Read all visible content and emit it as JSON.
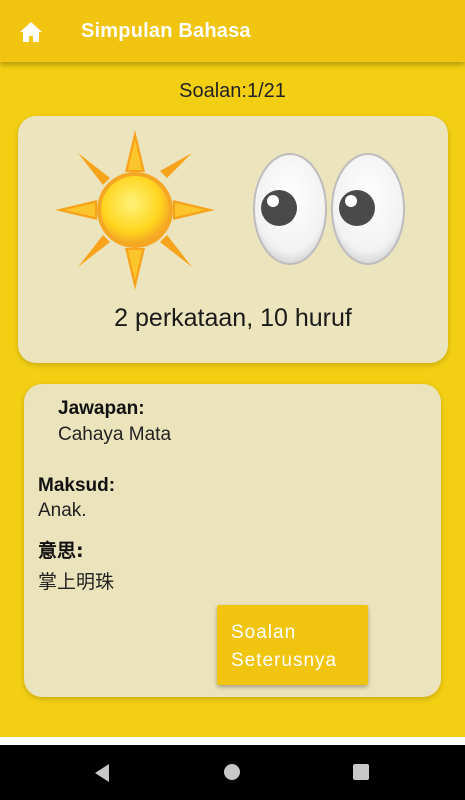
{
  "appbar": {
    "title": "Simpulan Bahasa",
    "home_icon": "home-icon"
  },
  "question": {
    "counter": "Soalan:1/21",
    "hint": "2 perkataan, 10 huruf",
    "images": [
      "sun-icon",
      "eyes-icon"
    ]
  },
  "answer": {
    "jawapan_label": "Jawapan:",
    "jawapan_value": "Cahaya Mata",
    "maksud_label": "Maksud:",
    "maksud_value": "Anak.",
    "yisi_label": "意思:",
    "yisi_value": "掌上明珠"
  },
  "next_button": {
    "line1": "Soalan",
    "line2": "Seterusnya"
  },
  "colors": {
    "accent": "#f1c40f",
    "background": "#f3cf14",
    "card": "#ece4bd"
  },
  "system_nav": {
    "back": "back-icon",
    "home": "home-circle-icon",
    "recent": "recent-apps-icon"
  }
}
